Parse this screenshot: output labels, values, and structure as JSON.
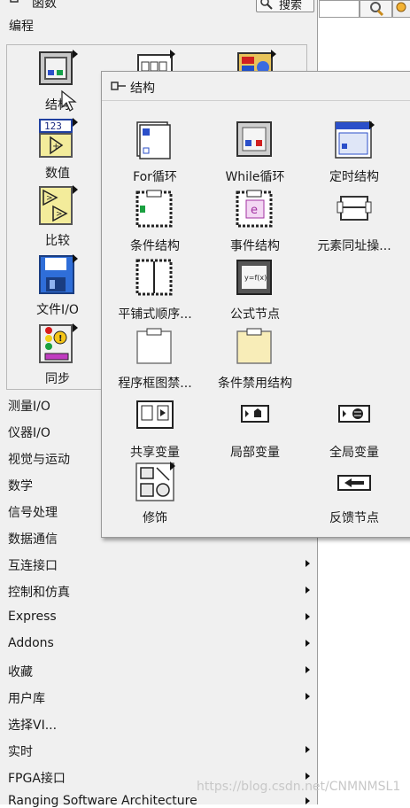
{
  "palette": {
    "title": "函数",
    "search_label": "搜索",
    "breadcrumb": "编程",
    "items": [
      {
        "label": "结构",
        "icon": "structure-icon"
      },
      {
        "label": "",
        "icon": "array-icon"
      },
      {
        "label": "",
        "icon": "cluster-icon"
      },
      {
        "label": "数值",
        "icon": "numeric-icon"
      },
      {
        "label": "比较",
        "icon": "comparison-icon"
      },
      {
        "label": "文件I/O",
        "icon": "file-io-icon"
      },
      {
        "label": "同步",
        "icon": "synchronization-icon"
      }
    ],
    "categories": [
      {
        "label": "测量I/O",
        "has_submenu": false
      },
      {
        "label": "仪器I/O",
        "has_submenu": false
      },
      {
        "label": "视觉与运动",
        "has_submenu": false
      },
      {
        "label": "数学",
        "has_submenu": false
      },
      {
        "label": "信号处理",
        "has_submenu": false
      },
      {
        "label": "数据通信",
        "has_submenu": false
      },
      {
        "label": "互连接口",
        "has_submenu": true
      },
      {
        "label": "控制和仿真",
        "has_submenu": true
      },
      {
        "label": "Express",
        "has_submenu": true
      },
      {
        "label": "Addons",
        "has_submenu": true
      },
      {
        "label": "收藏",
        "has_submenu": true
      },
      {
        "label": "用户库",
        "has_submenu": true
      },
      {
        "label": "选择VI...",
        "has_submenu": false
      },
      {
        "label": "实时",
        "has_submenu": true
      },
      {
        "label": "FPGA接口",
        "has_submenu": true
      },
      {
        "label": "Ranging Software Architecture",
        "has_submenu": true
      }
    ]
  },
  "submenu": {
    "title": "结构",
    "items": [
      {
        "label": "For循环",
        "icon": "for-loop-icon"
      },
      {
        "label": "While循环",
        "icon": "while-loop-icon"
      },
      {
        "label": "定时结构",
        "icon": "timed-structure-icon"
      },
      {
        "label": "条件结构",
        "icon": "case-structure-icon"
      },
      {
        "label": "事件结构",
        "icon": "event-structure-icon"
      },
      {
        "label": "元素同址操...",
        "icon": "in-place-element-icon"
      },
      {
        "label": "平铺式顺序...",
        "icon": "flat-sequence-icon"
      },
      {
        "label": "公式节点",
        "icon": "formula-node-icon"
      },
      {
        "label": "",
        "icon": "empty-slot"
      },
      {
        "label": "程序框图禁...",
        "icon": "diagram-disable-icon"
      },
      {
        "label": "条件禁用结构",
        "icon": "conditional-disable-icon"
      },
      {
        "label": "",
        "icon": "empty-slot"
      },
      {
        "label": "共享变量",
        "icon": "shared-variable-icon"
      },
      {
        "label": "局部变量",
        "icon": "local-variable-icon"
      },
      {
        "label": "全局变量",
        "icon": "global-variable-icon"
      },
      {
        "label": "修饰",
        "icon": "decorations-icon"
      },
      {
        "label": "",
        "icon": "empty-slot"
      },
      {
        "label": "反馈节点",
        "icon": "feedback-node-icon"
      }
    ]
  },
  "watermark": "https://blog.csdn.net/CNMNMSL1"
}
